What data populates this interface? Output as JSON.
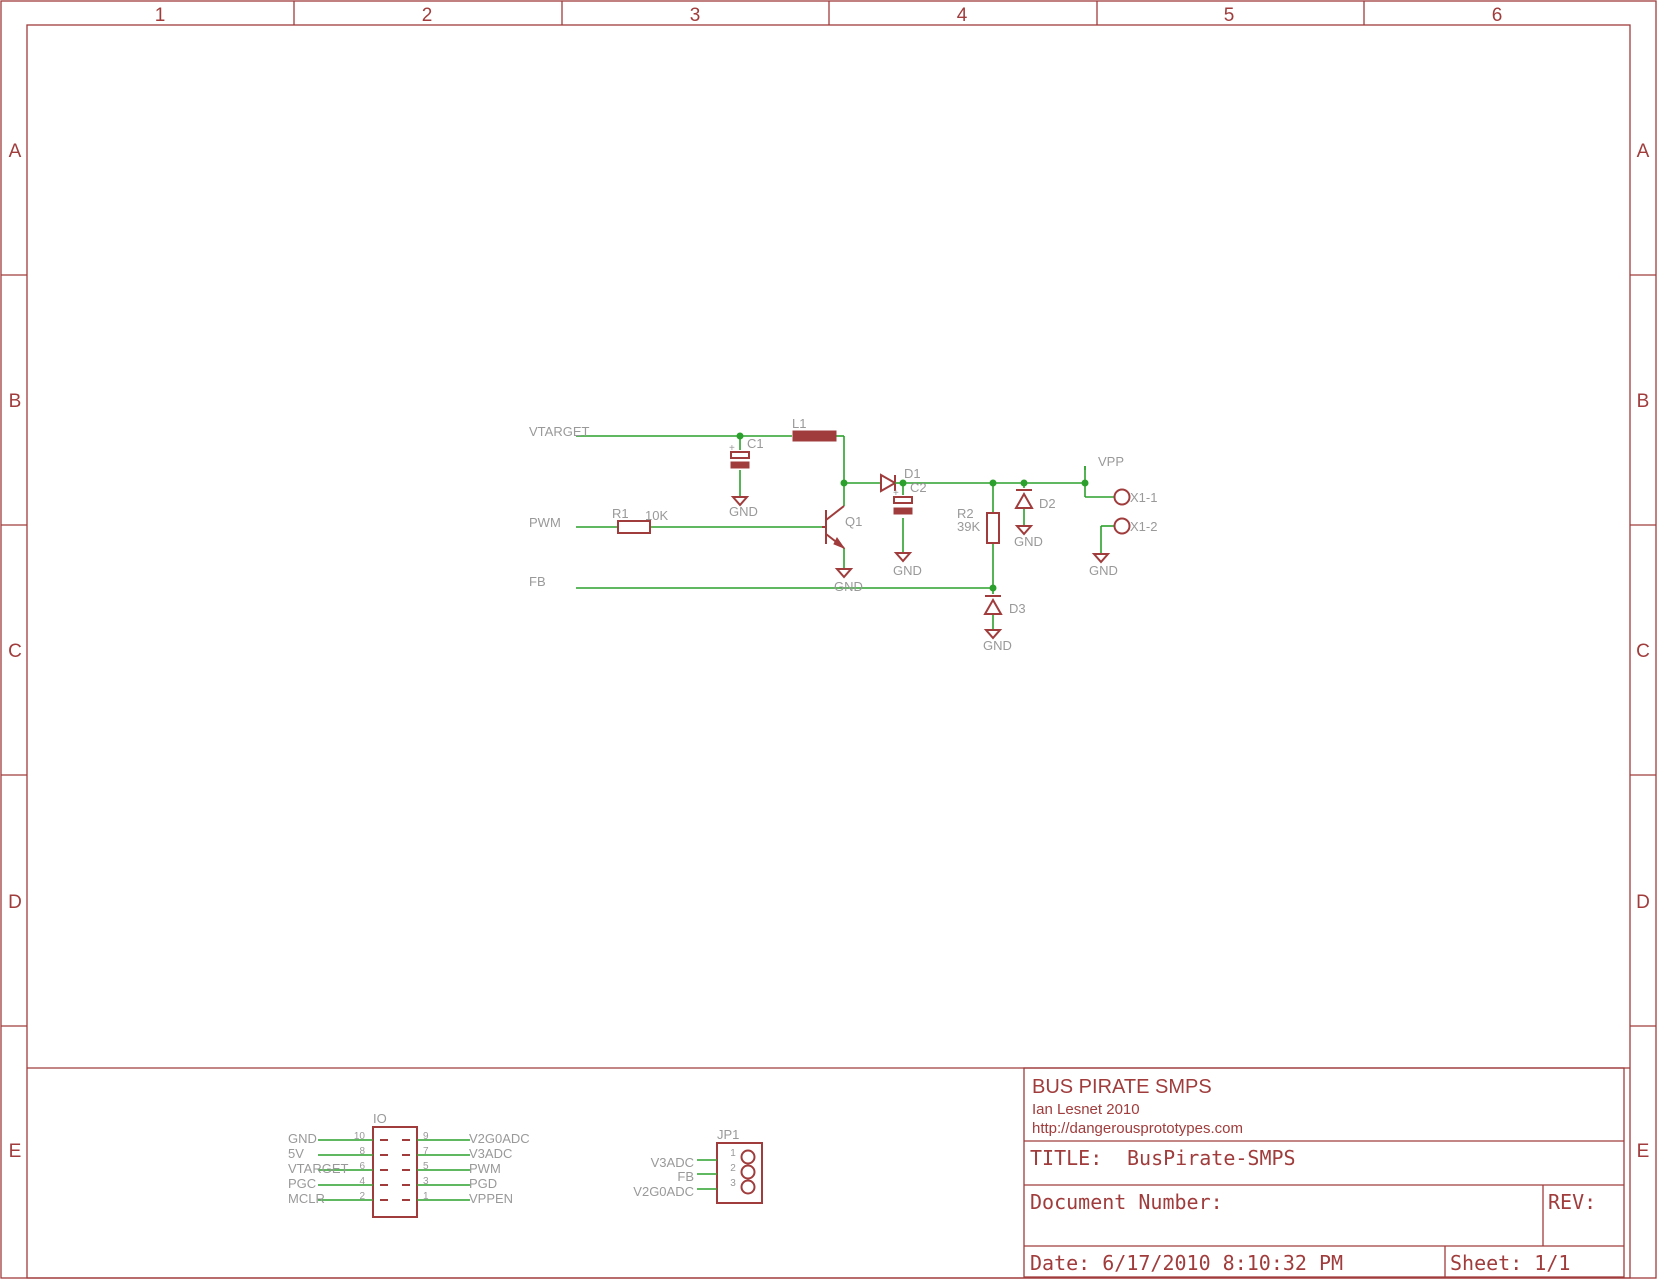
{
  "frame": {
    "columns": [
      "1",
      "2",
      "3",
      "4",
      "5",
      "6"
    ],
    "rows": [
      "A",
      "B",
      "C",
      "D",
      "E"
    ]
  },
  "nets": {
    "vtarget": "VTARGET",
    "pwm": "PWM",
    "fb": "FB",
    "vpp": "VPP",
    "gnd": "GND"
  },
  "parts": {
    "l1": "L1",
    "c1": "C1",
    "c2": "C2",
    "d1": "D1",
    "d2": "D2",
    "d3": "D3",
    "q1": "Q1",
    "r1": "R1",
    "r1_value": "10K",
    "r2": "R2",
    "r2_value": "39K",
    "x1_1": "X1-1",
    "x1_2": "X1-2",
    "io": "IO",
    "jp1": "JP1"
  },
  "io_header": {
    "left": [
      {
        "net": "GND",
        "pin": "10"
      },
      {
        "net": "5V",
        "pin": "8"
      },
      {
        "net": "VTARGET",
        "pin": "6"
      },
      {
        "net": "PGC",
        "pin": "4"
      },
      {
        "net": "MCLR",
        "pin": "2"
      }
    ],
    "right": [
      {
        "net": "V2G0ADC",
        "pin": "9"
      },
      {
        "net": "V3ADC",
        "pin": "7"
      },
      {
        "net": "PWM",
        "pin": "5"
      },
      {
        "net": "PGD",
        "pin": "3"
      },
      {
        "net": "VPPEN",
        "pin": "1"
      }
    ]
  },
  "jp1_header": [
    {
      "net": "V3ADC",
      "pin": "1"
    },
    {
      "net": "FB",
      "pin": "2"
    },
    {
      "net": "V2G0ADC",
      "pin": "3"
    }
  ],
  "title_block": {
    "project": "BUS PIRATE SMPS",
    "author": "Ian Lesnet 2010",
    "url": "http://dangerousprototypes.com",
    "title_label": "TITLE:",
    "title_value": "BusPirate-SMPS",
    "doc_number": "Document Number:",
    "rev": "REV:",
    "date": "Date: 6/17/2010 8:10:32 PM",
    "sheet": "Sheet: 1/1"
  }
}
